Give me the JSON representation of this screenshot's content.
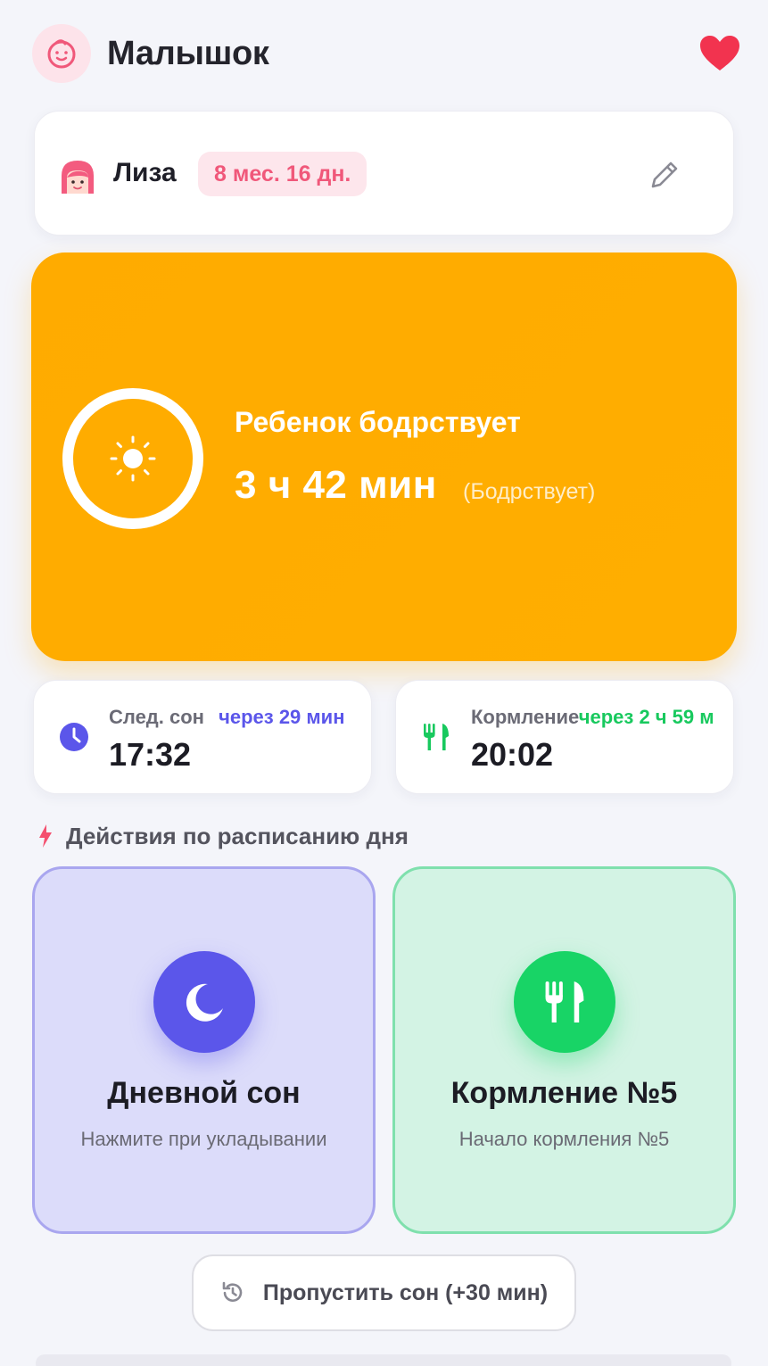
{
  "header": {
    "title": "Малышок"
  },
  "profile": {
    "name": "Лиза",
    "age": "8 мес. 16 дн."
  },
  "status": {
    "title": "Ребенок бодрствует",
    "duration": "3 ч 42 мин",
    "state_label": "(Бодрствует)"
  },
  "next_sleep": {
    "label": "След. сон",
    "eta": "через 29 мин",
    "time": "17:32"
  },
  "next_feeding": {
    "label": "Кормление",
    "eta": "через 2 ч 59 м",
    "time": "20:02"
  },
  "section": {
    "title": "Действия по расписанию дня"
  },
  "actions": [
    {
      "title": "Дневной сон",
      "subtitle": "Нажмите при укладывании"
    },
    {
      "title": "Кормление №5",
      "subtitle": "Начало кормления №5"
    }
  ],
  "skip_button": {
    "label": "Пропустить сон (+30 мин)"
  },
  "colors": {
    "status_bg": "#ffab00",
    "sleep_accent": "#5b56ea",
    "feed_accent": "#18d466",
    "age_badge": "#f0587a",
    "heart": "#f2334f"
  }
}
